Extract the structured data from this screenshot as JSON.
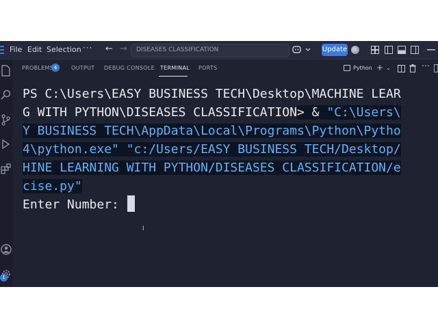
{
  "menu": {
    "items": [
      "File",
      "Edit",
      "Selection"
    ],
    "more": "···"
  },
  "command_center": {
    "text": "DISEASES CLASSIFICATION"
  },
  "update": {
    "label": "Update"
  },
  "panel": {
    "tabs": [
      "PROBLEMS",
      "OUTPUT",
      "DEBUG CONSOLE",
      "TERMINAL",
      "PORTS"
    ],
    "active_tab": "TERMINAL",
    "problems_count": "4",
    "shell_label": "Python"
  },
  "activity": {
    "badge": "1"
  },
  "terminal": {
    "line1": "PS C:\\Users\\EASY BUSINESS TECH\\Desktop\\MACHINE LEAR",
    "line2_prompt": "G WITH PYTHON\\DISEASES CLASSIFICATION",
    "line2_gt": ">",
    "line2_amp": " & ",
    "line2_sel": "\"C:\\Users\\",
    "line3": "Y BUSINESS TECH\\AppData\\Local\\Programs\\Python\\Pytho",
    "line4": "4\\python.exe\" \"c:/Users/EASY BUSINESS TECH/Desktop/",
    "line5": "HINE LEARNING WITH PYTHON/DISEASES CLASSIFICATION/e",
    "line6": "cise.py\"",
    "line7": "Enter Number: "
  },
  "colors": {
    "background": "#1f2230",
    "selection": "#0c1323",
    "selected_text": "#5ab4f7",
    "accent": "#3a7be0"
  },
  "icons": [
    "menu-icon",
    "back-arrow-icon",
    "forward-arrow-icon",
    "copilot-icon",
    "chevron-down-icon",
    "gear-icon",
    "layout-icon",
    "sidebar-icon",
    "panel-icon",
    "explorer-icon",
    "search-icon",
    "source-control-icon",
    "run-debug-icon",
    "extensions-icon",
    "account-icon",
    "settings-icon",
    "terminal-shell-icon",
    "add-icon",
    "split-icon",
    "trash-icon",
    "more-icon"
  ]
}
